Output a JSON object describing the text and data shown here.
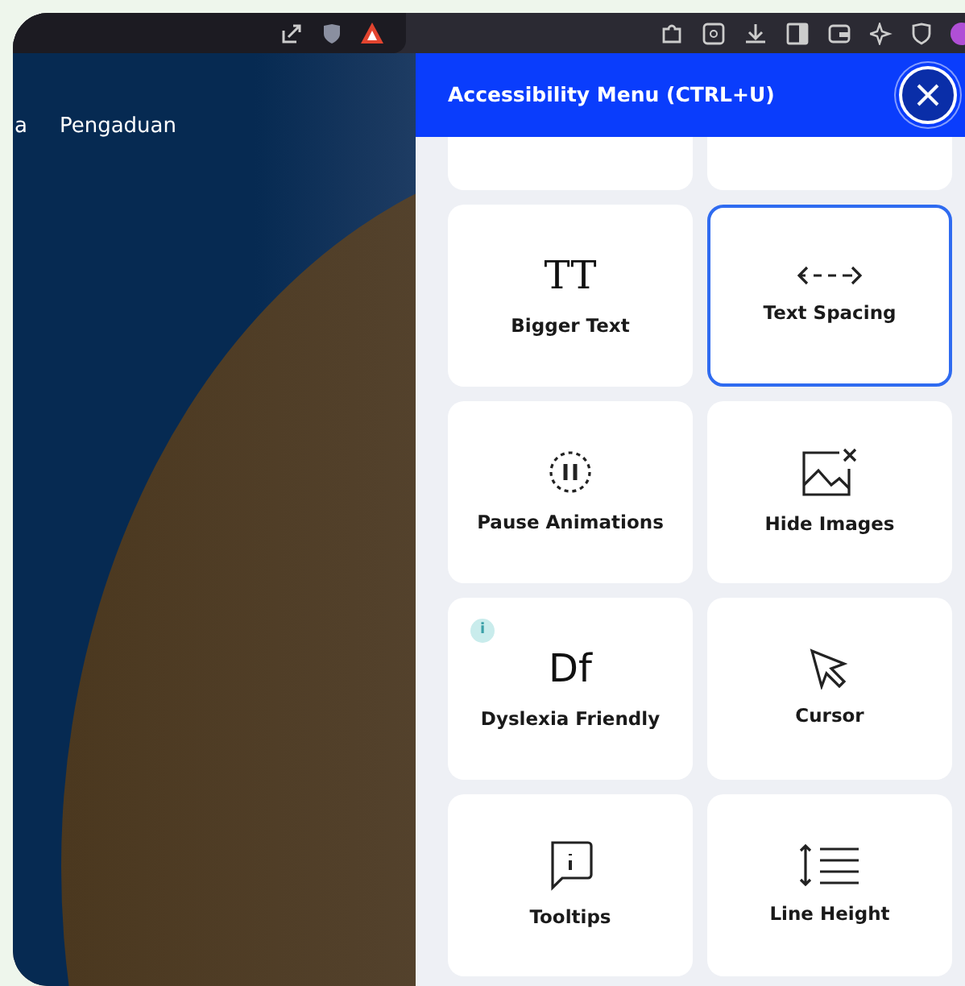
{
  "page": {
    "nav_items": [
      "a",
      "Pengaduan"
    ]
  },
  "panel": {
    "title": "Accessibility Menu (CTRL+U)",
    "tiles": [
      {
        "kind": "bigger_text",
        "icon_text": "TT",
        "label": "Bigger Text",
        "selected": false,
        "info": false
      },
      {
        "kind": "text_spacing",
        "label": "Text Spacing",
        "selected": true,
        "info": false
      },
      {
        "kind": "pause_animations",
        "label": "Pause Animations",
        "selected": false,
        "info": false
      },
      {
        "kind": "hide_images",
        "label": "Hide Images",
        "selected": false,
        "info": false
      },
      {
        "kind": "dyslexia",
        "icon_text": "Df",
        "label": "Dyslexia Friendly",
        "selected": false,
        "info": true,
        "info_text": "i"
      },
      {
        "kind": "cursor",
        "label": "Cursor",
        "selected": false,
        "info": false
      },
      {
        "kind": "tooltips",
        "label": "Tooltips",
        "selected": false,
        "info": false
      },
      {
        "kind": "line_height",
        "label": "Line Height",
        "selected": false,
        "info": false
      }
    ]
  }
}
